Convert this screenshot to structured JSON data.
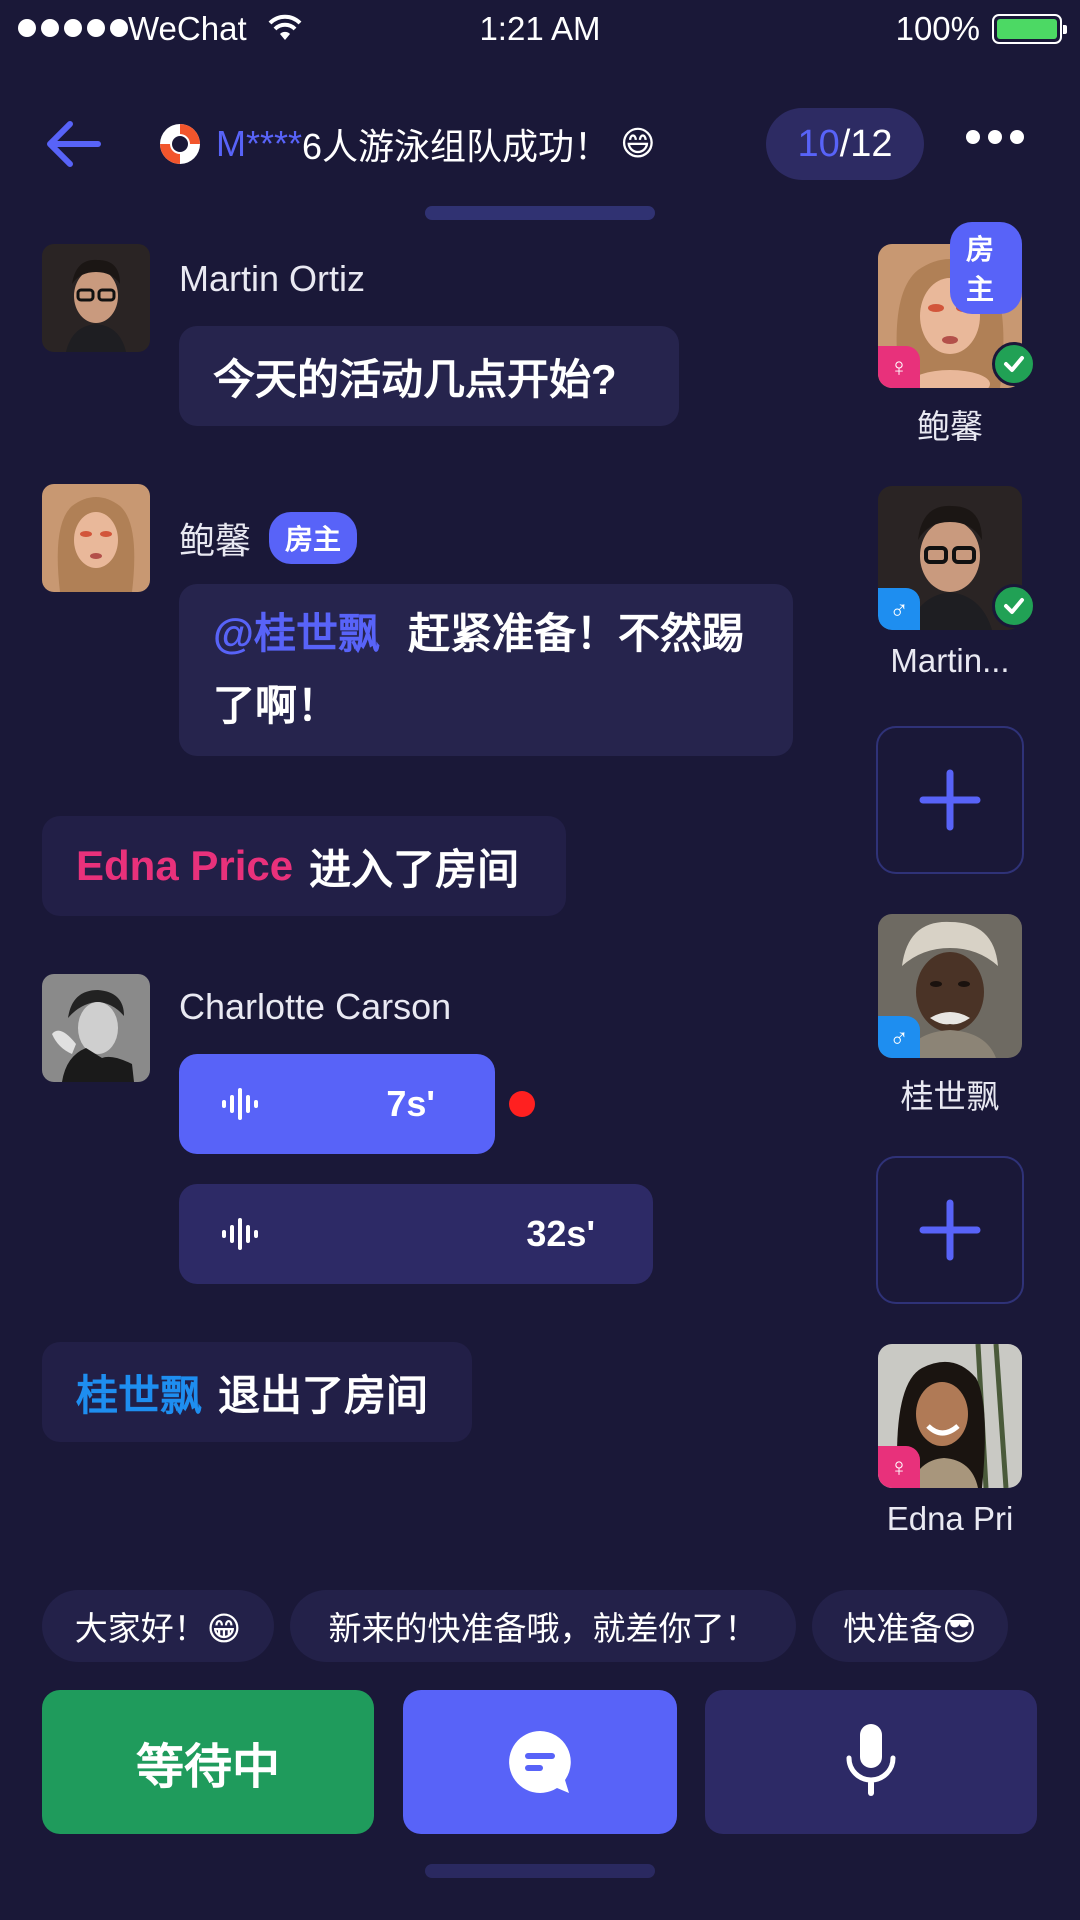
{
  "status_bar": {
    "carrier": "WeChat",
    "time": "1:21 AM",
    "battery": "100%"
  },
  "header": {
    "title_highlight": "M****",
    "title_rest": "6人游泳组队成功！",
    "title_emoji": "😄",
    "count_current": "10",
    "count_total": "/12"
  },
  "messages": {
    "m1": {
      "sender": "Martin Ortiz",
      "text": "今天的活动几点开始?"
    },
    "m2": {
      "sender": "鲍馨",
      "badge": "房主",
      "mention": "@桂世飘",
      "text": "赶紧准备！不然踢了啊！"
    },
    "sys1": {
      "name": "Edna Price",
      "text": "进入了房间",
      "name_color": "#e8317b"
    },
    "m3": {
      "sender": "Charlotte Carson",
      "voice1_duration": "7s'",
      "voice2_duration": "32s'"
    },
    "sys2": {
      "name": "桂世飘",
      "text": "退出了房间",
      "name_color": "#1e8ef0"
    }
  },
  "seats": [
    {
      "name": "鲍馨",
      "badge": "房主",
      "gender": "female",
      "ready": true
    },
    {
      "name": "Martin...",
      "gender": "male",
      "ready": true
    },
    {
      "empty": true
    },
    {
      "name": "桂世飘",
      "gender": "male",
      "ready": false
    },
    {
      "empty": true
    },
    {
      "name": "Edna Pri",
      "gender": "female",
      "ready": false
    }
  ],
  "quick_replies": [
    "大家好！😁",
    "新来的快准备哦，就差你了！",
    "快准备😎"
  ],
  "actions": {
    "waiting_label": "等待中"
  },
  "colors": {
    "background": "#1a1838",
    "accent": "#5863f8",
    "bubble": "#26244d",
    "ready_green": "#21a155",
    "female": "#e8317b",
    "male": "#1e8ef0",
    "recording_dot": "#ff2020"
  },
  "icons": {
    "back": "arrow-left-icon",
    "title": "lifebuoy-icon",
    "more": "more-dots-icon",
    "voice": "waveform-icon",
    "add_seat": "plus-icon",
    "chat": "chat-bubble-icon",
    "mic": "microphone-icon",
    "ready": "check-icon"
  }
}
